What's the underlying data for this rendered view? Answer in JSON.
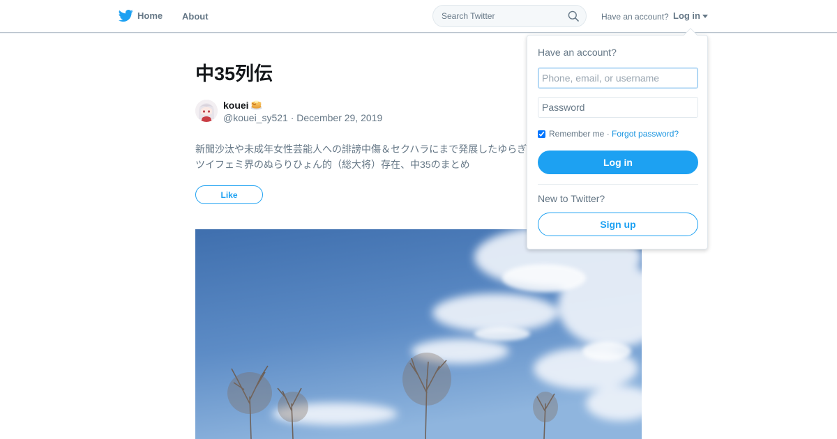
{
  "nav": {
    "home_label": "Home",
    "about_label": "About",
    "twitter_icon": "twitter-bird-icon"
  },
  "search": {
    "placeholder": "Search Twitter",
    "icon": "search-icon"
  },
  "account": {
    "have_account_text": "Have an account?",
    "login_label": "Log in"
  },
  "moment": {
    "title": "中35列伝",
    "author_name": "kouei",
    "author_badge_icon": "pancake-icon",
    "handle": "@kouei_sy521",
    "separator": " · ",
    "date": "December 29, 2019",
    "description": "新聞沙汰や未成年女性芸能人への誹謗中傷＆セクハラにまで発展したゆらぎ\nツイフェミ界のぬらりひょん的（総大将）存在、中35のまとめ",
    "like_label": "Like"
  },
  "login_dropdown": {
    "heading": "Have an account?",
    "username_placeholder": "Phone, email, or username",
    "password_placeholder": "Password",
    "remember_label": "Remember me",
    "remember_checked": true,
    "remember_separator": " · ",
    "forgot_label": "Forgot password?",
    "login_button": "Log in",
    "new_text": "New to Twitter?",
    "signup_button": "Sign up"
  },
  "colors": {
    "brand_blue": "#1da1f2",
    "text_gray": "#657786",
    "text_dark": "#14171a"
  }
}
